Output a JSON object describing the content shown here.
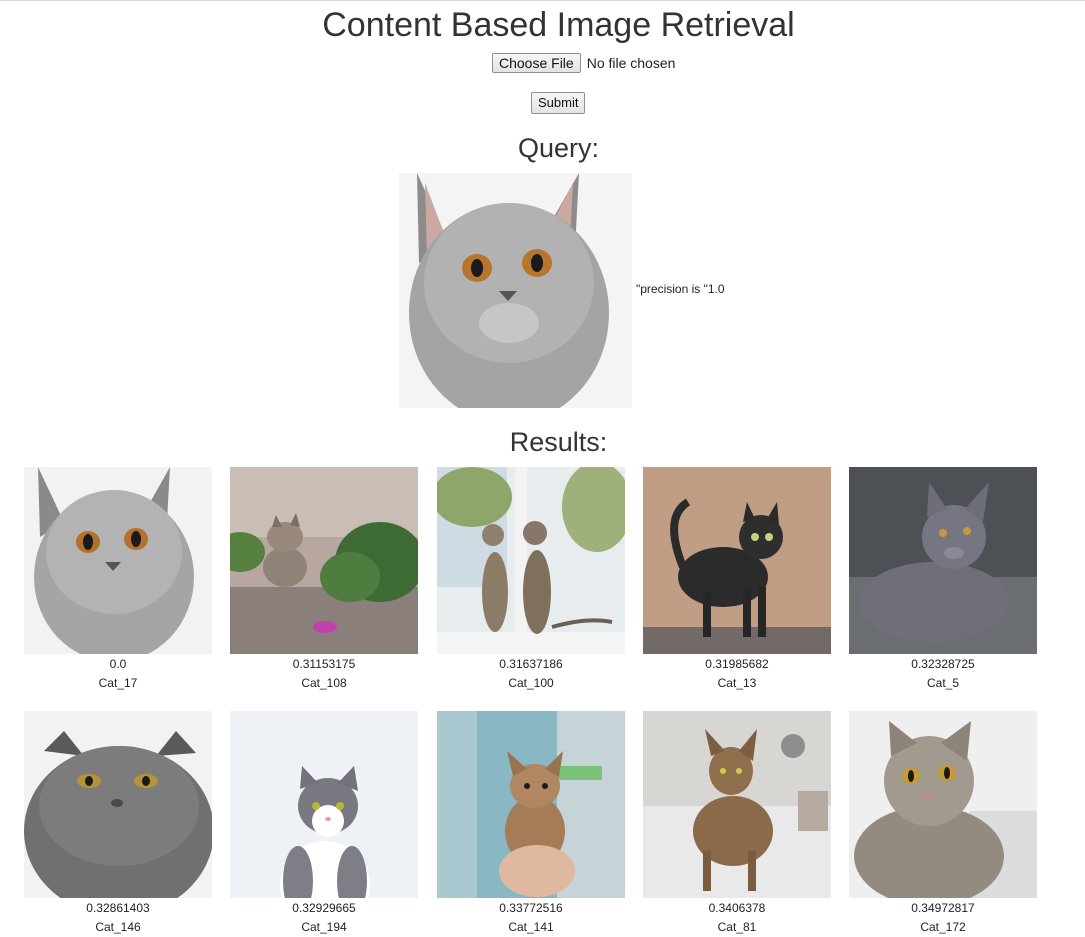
{
  "page": {
    "title": "Content Based Image Retrieval"
  },
  "upload": {
    "choose_label": "Choose File",
    "status": "No file chosen",
    "submit_label": "Submit"
  },
  "query": {
    "heading": "Query:",
    "precision_text": "\"precision is \"1.0",
    "image_desc": "grey-cat-face"
  },
  "results": {
    "heading": "Results:",
    "items": [
      {
        "score": "0.0",
        "label": "Cat_17"
      },
      {
        "score": "0.31153175",
        "label": "Cat_108"
      },
      {
        "score": "0.31637186",
        "label": "Cat_100"
      },
      {
        "score": "0.31985682",
        "label": "Cat_13"
      },
      {
        "score": "0.32328725",
        "label": "Cat_5"
      },
      {
        "score": "0.32861403",
        "label": "Cat_146"
      },
      {
        "score": "0.32929665",
        "label": "Cat_194"
      },
      {
        "score": "0.33772516",
        "label": "Cat_141"
      },
      {
        "score": "0.3406378",
        "label": "Cat_81"
      },
      {
        "score": "0.34972817",
        "label": "Cat_172"
      }
    ]
  }
}
